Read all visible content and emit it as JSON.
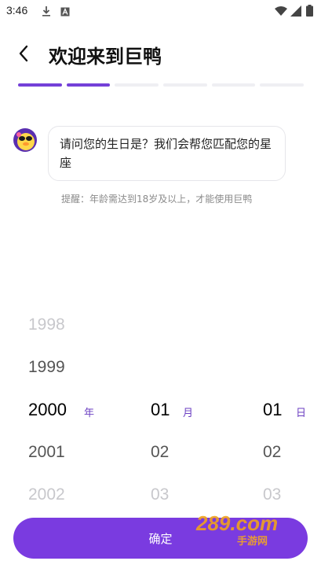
{
  "status_bar": {
    "time": "3:46"
  },
  "header": {
    "title": "欢迎来到巨鸭"
  },
  "progress": {
    "total_steps": 6,
    "completed_steps": 2
  },
  "chat": {
    "question": "请问您的生日是？我们会帮您匹配您的星座",
    "hint": "提醒：年龄需达到18岁及以上，才能使用巨鸭"
  },
  "picker": {
    "year": {
      "unit": "年",
      "items": [
        "1998",
        "1999",
        "2000",
        "2001",
        "2002"
      ],
      "selected": "2000"
    },
    "month": {
      "unit": "月",
      "items": [
        "01",
        "02",
        "03"
      ],
      "selected": "01"
    },
    "day": {
      "unit": "日",
      "items": [
        "01",
        "02",
        "03"
      ],
      "selected": "01"
    }
  },
  "footer": {
    "confirm_label": "确定"
  },
  "watermark": {
    "text": "289.com",
    "sub": "手游网"
  },
  "colors": {
    "accent": "#7a3be0",
    "progress_active": "#7440d8",
    "unit": "#6b3fc2"
  }
}
